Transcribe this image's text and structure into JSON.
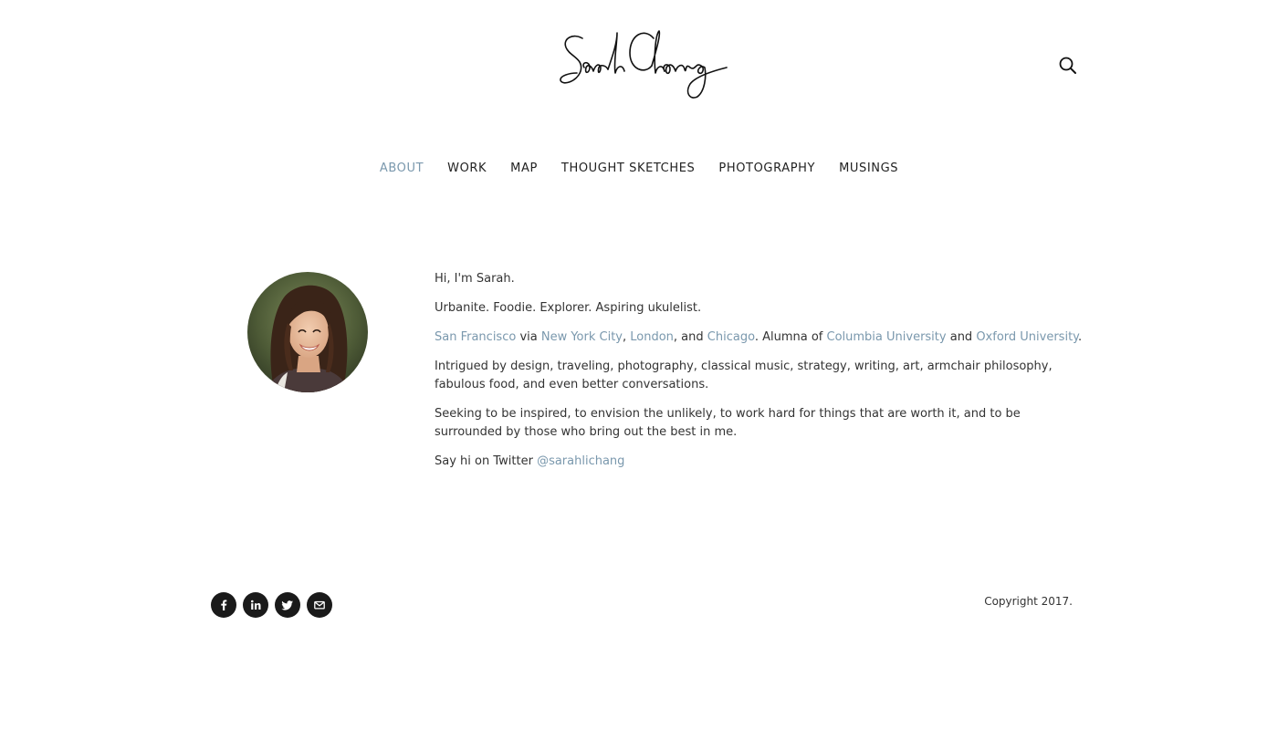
{
  "header": {
    "logo_text": "Sarah Chang",
    "logo_icon": "signature-logo",
    "search_icon": "search-icon"
  },
  "nav": {
    "items": [
      {
        "label": "ABOUT",
        "active": true
      },
      {
        "label": "WORK",
        "active": false
      },
      {
        "label": "MAP",
        "active": false
      },
      {
        "label": "THOUGHT SKETCHES",
        "active": false
      },
      {
        "label": "PHOTOGRAPHY",
        "active": false
      },
      {
        "label": "MUSINGS",
        "active": false
      }
    ]
  },
  "bio": {
    "greeting": "Hi, I'm Sarah.",
    "tagline": "Urbanite. Foodie. Explorer. Aspiring ukulelist.",
    "cities": {
      "sf": "San Francisco",
      "via": " via ",
      "nyc": "New York City",
      "comma1": ", ",
      "london": "London",
      "and1": ", and ",
      "chicago": "Chicago",
      "alumna": ". Alumna of ",
      "columbia": "Columbia University",
      "and2": " and ",
      "oxford": "Oxford University",
      "period": "."
    },
    "interests": "Intrigued by design, traveling, photography, classical music, strategy, writing, art, armchair philosophy, fabulous food, and even better conversations.",
    "seeking": "Seeking to be inspired, to envision the unlikely, to work hard for things that are worth it, and to be surrounded by those who bring out the best in me.",
    "twitter_prefix": "Say hi on Twitter ",
    "twitter_handle": "@sarahlichang"
  },
  "footer": {
    "social": [
      {
        "icon": "facebook-icon"
      },
      {
        "icon": "linkedin-icon"
      },
      {
        "icon": "twitter-icon"
      },
      {
        "icon": "email-icon"
      }
    ],
    "copyright": "Copyright 2017."
  },
  "colors": {
    "accent": "#7a98ad",
    "text": "#333333",
    "social_bg": "#1a1a1a"
  }
}
